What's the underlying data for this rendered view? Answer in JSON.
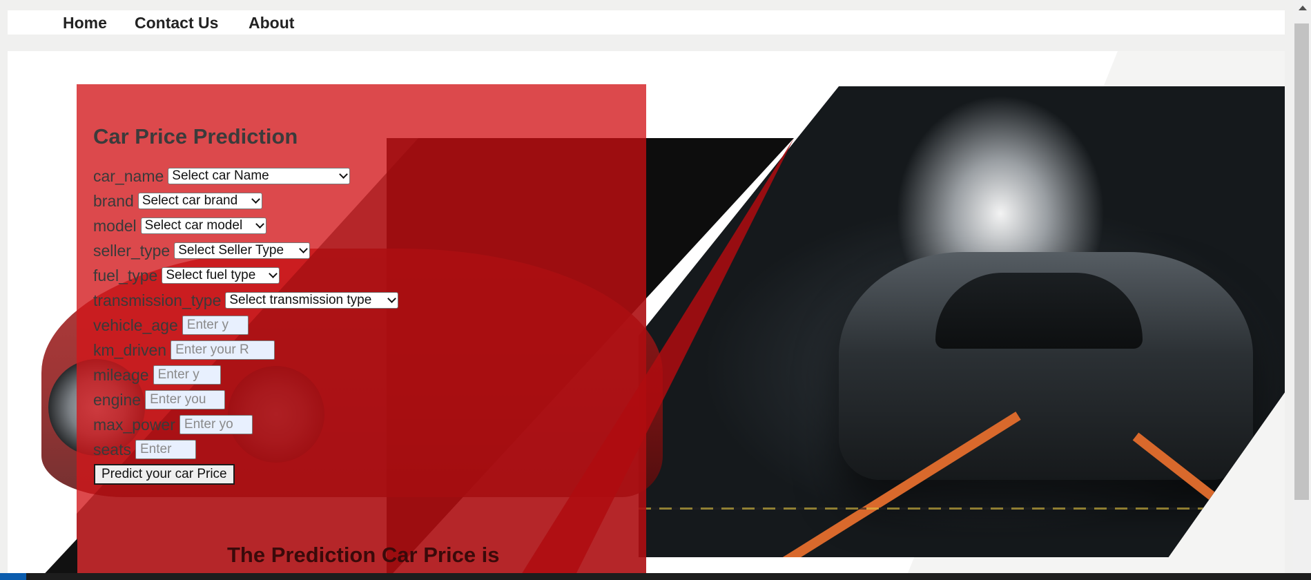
{
  "nav": {
    "items": [
      {
        "label": "Home"
      },
      {
        "label": "Contact Us"
      },
      {
        "label": "About"
      }
    ]
  },
  "form": {
    "title": "Car Price Prediction",
    "fields": [
      {
        "label": "car_name",
        "kind": "select",
        "value": "Select car Name"
      },
      {
        "label": "brand",
        "kind": "select",
        "value": "Select car brand"
      },
      {
        "label": "model",
        "kind": "select",
        "value": "Select car model"
      },
      {
        "label": "seller_type",
        "kind": "select",
        "value": "Select Seller Type"
      },
      {
        "label": "fuel_type",
        "kind": "select",
        "value": "Select fuel type"
      },
      {
        "label": "transmission_type",
        "kind": "select",
        "value": "Select transmission type"
      },
      {
        "label": "vehicle_age",
        "kind": "input",
        "placeholder": "Enter y"
      },
      {
        "label": "km_driven",
        "kind": "input",
        "placeholder": "Enter your R"
      },
      {
        "label": "mileage",
        "kind": "input",
        "placeholder": "Enter y"
      },
      {
        "label": "engine",
        "kind": "input",
        "placeholder": "Enter you"
      },
      {
        "label": "max_power",
        "kind": "input",
        "placeholder": "Enter yo"
      },
      {
        "label": "seats",
        "kind": "input",
        "placeholder": "Enter"
      }
    ],
    "submit_label": "Predict your car Price"
  },
  "result": {
    "heading": "The Prediction Car Price is"
  },
  "colors": {
    "form_panel": "#d21619",
    "title_text": "#3b3b3b",
    "input_fill": "#e8f0fe",
    "strap_orange": "#d9692c"
  },
  "icons": [
    "chevron-down-icon",
    "scroll-up-arrow-icon"
  ]
}
